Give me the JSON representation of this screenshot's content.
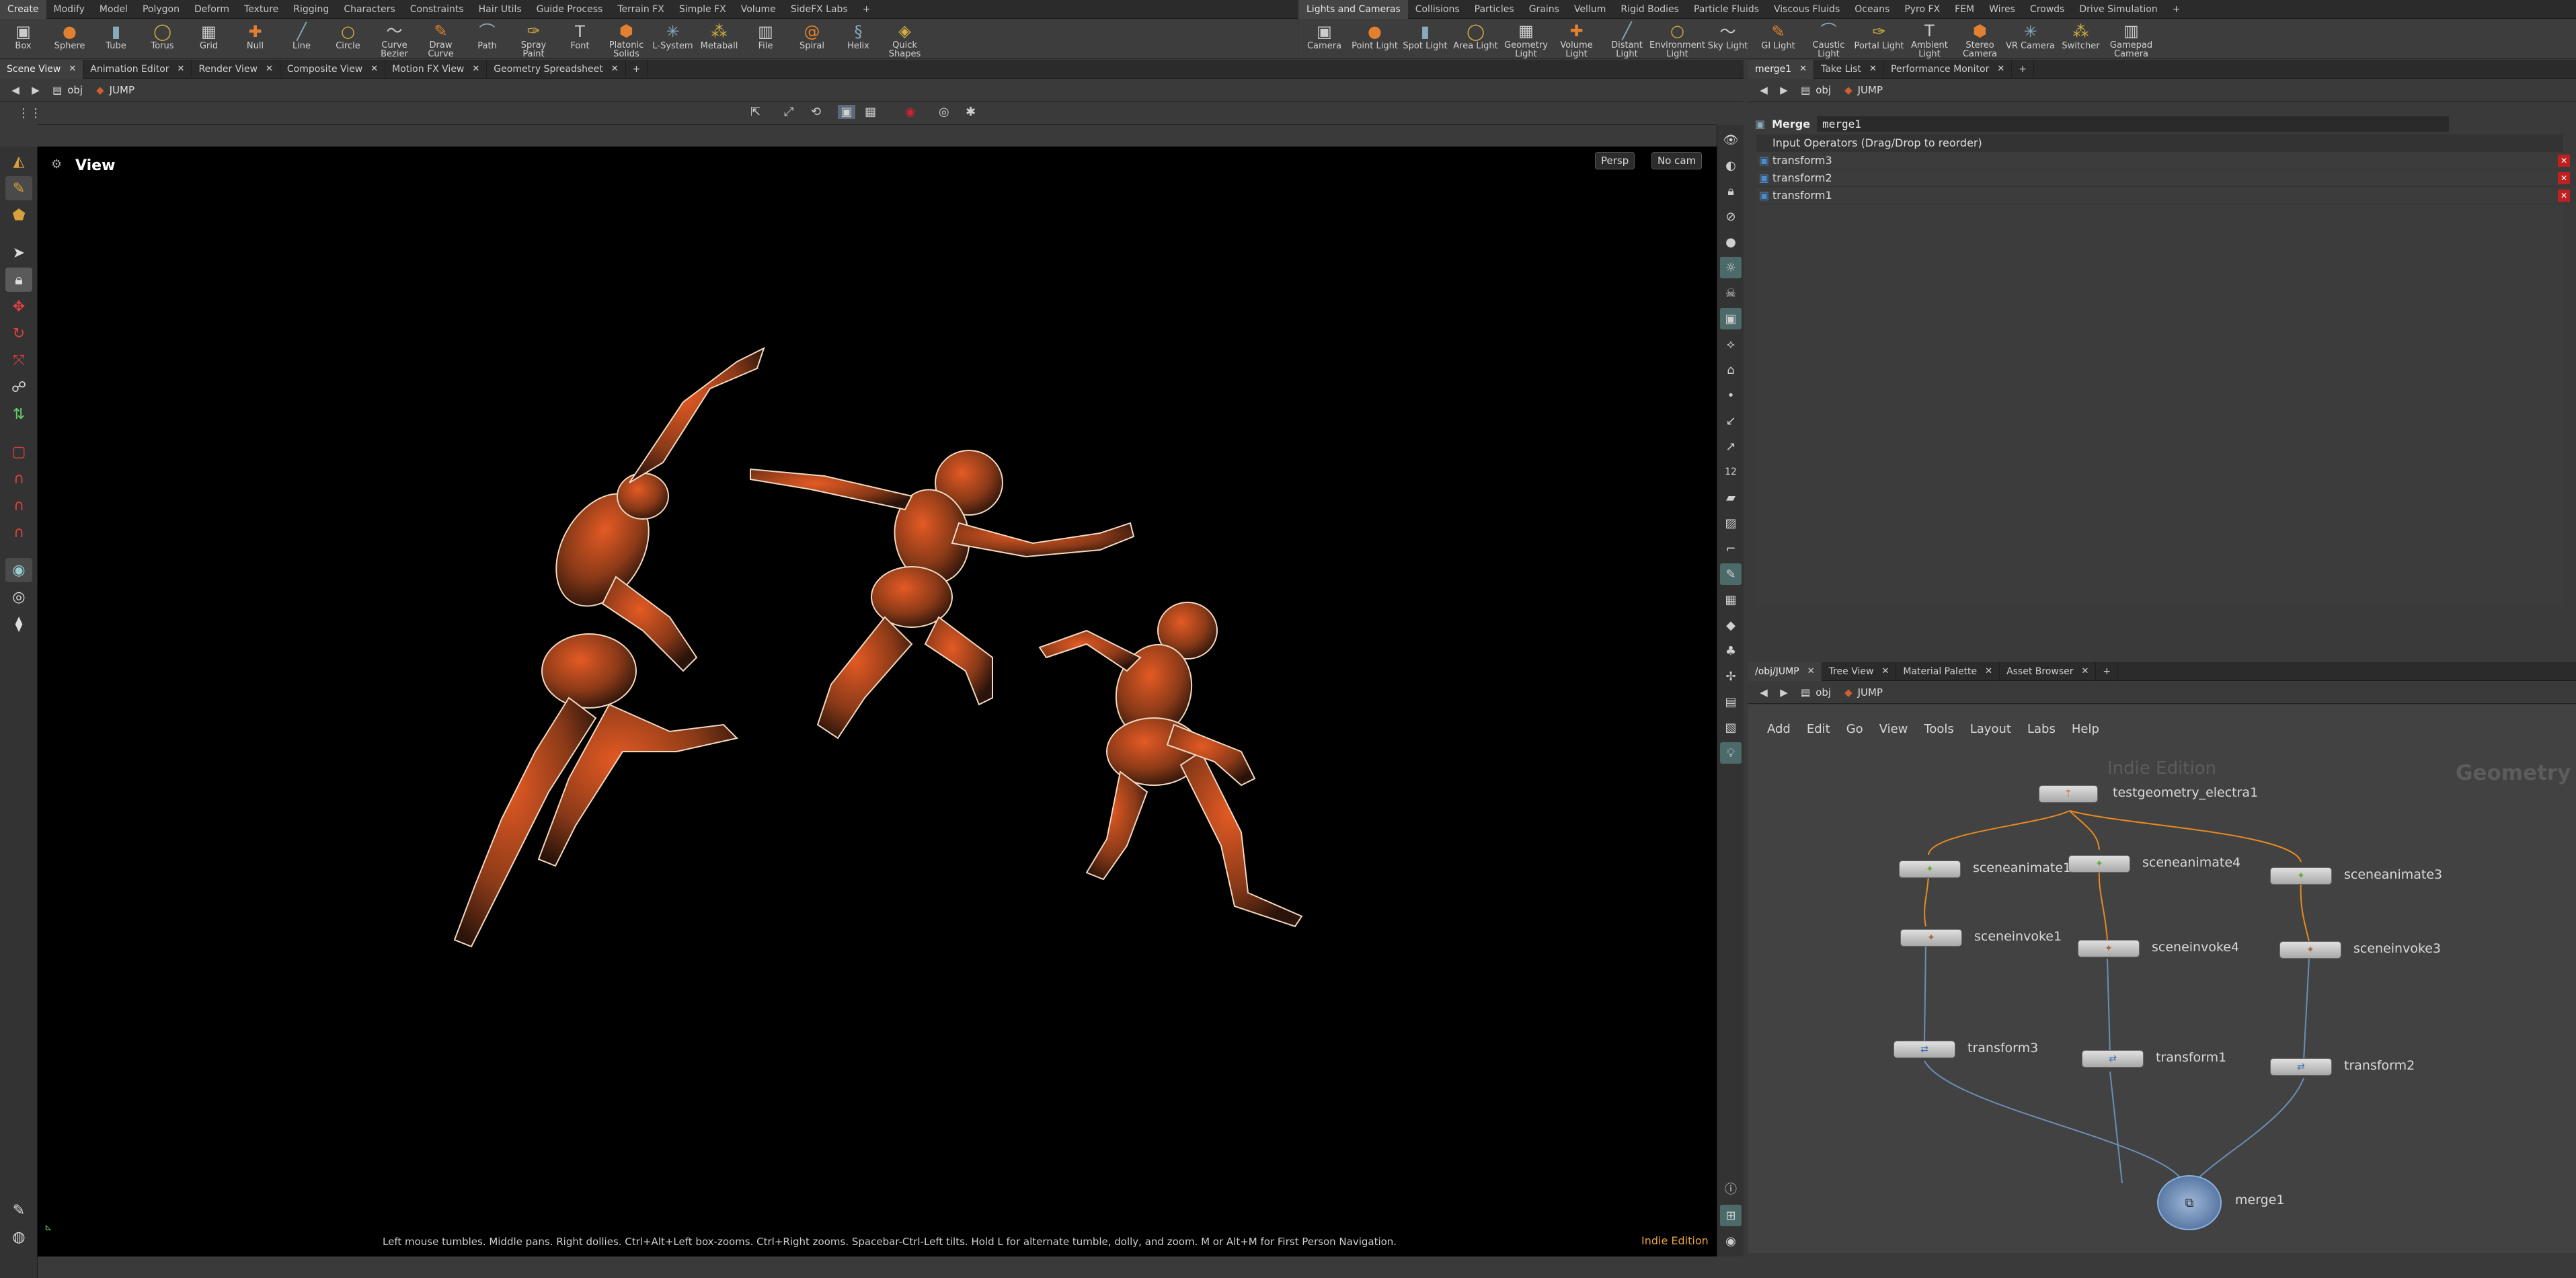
{
  "shelf_left": {
    "tabs": [
      "Create",
      "Modify",
      "Model",
      "Polygon",
      "Deform",
      "Texture",
      "Rigging",
      "Characters",
      "Constraints",
      "Hair Utils",
      "Guide Process",
      "Terrain FX",
      "Simple FX",
      "Volume",
      "SideFX Labs"
    ],
    "tools": [
      {
        "label": "Box",
        "icon": "box-icon"
      },
      {
        "label": "Sphere",
        "icon": "sphere-icon"
      },
      {
        "label": "Tube",
        "icon": "tube-icon"
      },
      {
        "label": "Torus",
        "icon": "torus-icon"
      },
      {
        "label": "Grid",
        "icon": "grid-icon"
      },
      {
        "label": "Null",
        "icon": "null-icon"
      },
      {
        "label": "Line",
        "icon": "line-icon"
      },
      {
        "label": "Circle",
        "icon": "circle-icon"
      },
      {
        "label": "Curve Bezier",
        "icon": "curve-icon"
      },
      {
        "label": "Draw Curve",
        "icon": "draw-curve-icon"
      },
      {
        "label": "Path",
        "icon": "path-icon"
      },
      {
        "label": "Spray Paint",
        "icon": "spray-icon"
      },
      {
        "label": "Font",
        "icon": "font-icon"
      },
      {
        "label": "Platonic Solids",
        "icon": "platonic-icon"
      },
      {
        "label": "L-System",
        "icon": "lsystem-icon"
      },
      {
        "label": "Metaball",
        "icon": "metaball-icon"
      },
      {
        "label": "File",
        "icon": "file-icon"
      },
      {
        "label": "Spiral",
        "icon": "spiral-icon"
      },
      {
        "label": "Helix",
        "icon": "helix-icon"
      },
      {
        "label": "Quick Shapes",
        "icon": "quick-shapes-icon"
      }
    ]
  },
  "shelf_right": {
    "tabs": [
      "Lights and Cameras",
      "Collisions",
      "Particles",
      "Grains",
      "Vellum",
      "Rigid Bodies",
      "Particle Fluids",
      "Viscous Fluids",
      "Oceans",
      "Pyro FX",
      "FEM",
      "Wires",
      "Crowds",
      "Drive Simulation"
    ],
    "tools": [
      {
        "label": "Camera"
      },
      {
        "label": "Point Light"
      },
      {
        "label": "Spot Light"
      },
      {
        "label": "Area Light"
      },
      {
        "label": "Geometry Light"
      },
      {
        "label": "Volume Light"
      },
      {
        "label": "Distant Light"
      },
      {
        "label": "Environment Light"
      },
      {
        "label": "Sky Light"
      },
      {
        "label": "GI Light"
      },
      {
        "label": "Caustic Light"
      },
      {
        "label": "Portal Light"
      },
      {
        "label": "Ambient Light"
      },
      {
        "label": "Stereo Camera"
      },
      {
        "label": "VR Camera"
      },
      {
        "label": "Switcher"
      },
      {
        "label": "Gamepad Camera"
      }
    ]
  },
  "left_pane": {
    "tabs": [
      "Scene View",
      "Animation Editor",
      "Render View",
      "Composite View",
      "Motion FX View",
      "Geometry Spreadsheet"
    ],
    "path": {
      "root": "obj",
      "node": "JUMP"
    },
    "viewport": {
      "title": "View",
      "persp": "Persp",
      "cam": "No cam",
      "status": "Left mouse tumbles. Middle pans. Right dollies. Ctrl+Alt+Left box-zooms. Ctrl+Right zooms. Spacebar-Ctrl-Left tilts. Hold L for alternate tumble, dolly, and zoom. M or Alt+M for First Person Navigation.",
      "edition": "Indie Edition"
    }
  },
  "param_pane": {
    "tabs": [
      "merge1",
      "Take List",
      "Performance Monitor"
    ],
    "path": {
      "root": "obj",
      "node": "JUMP"
    },
    "node_type": "Merge",
    "node_name": "merge1",
    "inputs_header": "Input Operators (Drag/Drop to reorder)",
    "inputs": [
      "transform3",
      "transform2",
      "transform1"
    ]
  },
  "network_pane": {
    "tabs": [
      "/obj/JUMP",
      "Tree View",
      "Material Palette",
      "Asset Browser"
    ],
    "path": {
      "root": "obj",
      "node": "JUMP"
    },
    "menu": [
      "Add",
      "Edit",
      "Go",
      "View",
      "Tools",
      "Layout",
      "Labs",
      "Help"
    ],
    "watermark": "Indie Edition",
    "context": "Geometry",
    "nodes": {
      "source": "testgeometry_electra1",
      "animate1": "sceneanimate1",
      "animate4": "sceneanimate4",
      "animate3": "sceneanimate3",
      "invoke1": "sceneinvoke1",
      "invoke4": "sceneinvoke4",
      "invoke3": "sceneinvoke3",
      "transform3": "transform3",
      "transform1": "transform1",
      "transform2": "transform2",
      "merge": "merge1"
    }
  },
  "colors": {
    "accent": "#e8a33d",
    "link_orange": "#e88a1f",
    "wire_blue": "#6a8fb5",
    "bg_dark": "#2b2b2b",
    "viewport": "#000000"
  }
}
